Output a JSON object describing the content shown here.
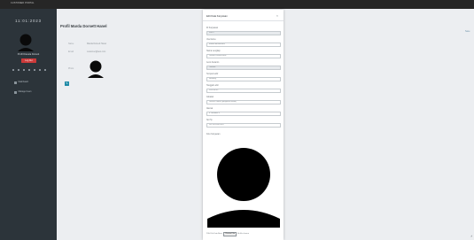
{
  "navbar": {
    "brand": "CUSTOMER PORTAL"
  },
  "sidebar": {
    "clock": "11:01:2023",
    "user_name": "Profil Dianela Dorsett",
    "logout_label": "Log Out",
    "items": [
      {
        "label": "Dashboard",
        "icon": "home-icon"
      },
      {
        "label": "Manage Users",
        "icon": "users-icon"
      }
    ]
  },
  "main": {
    "title": "Profil Marda Dorsett Hanel",
    "fields": [
      {
        "label": "Name",
        "value": "Marda Dorsett Hanel"
      },
      {
        "label": "Email",
        "value": "customer@test.com"
      },
      {
        "label": "Photo",
        "value": ""
      }
    ],
    "edit_icon": "pencil-icon",
    "save_label": "Save"
  },
  "modal": {
    "title": "Edit Data Karyawan",
    "close_icon": "close-icon",
    "fields": [
      {
        "label": "ID Karyawan",
        "value": "00013",
        "readonly": true
      },
      {
        "label": "Username",
        "value": "dianela.dorsetthane",
        "readonly": false
      },
      {
        "label": "Nama Lengkap",
        "value": "Dianela Dorsett Hane",
        "readonly": false
      },
      {
        "label": "Jenis Kelamin",
        "value": "Laki-laki",
        "readonly": true
      },
      {
        "label": "Tempat Lahir",
        "value": "Bandung",
        "readonly": false
      },
      {
        "label": "Tanggal Lahir",
        "value": "2023-04-05",
        "readonly": false
      },
      {
        "label": "Jabatan",
        "value": "Directur Utama (pengelola utama)",
        "readonly": false
      },
      {
        "label": "Alamat",
        "value": "Jl. Merdeka 5",
        "readonly": false
      },
      {
        "label": "No Hp",
        "value": "+62 81234567890",
        "readonly": false
      }
    ],
    "photo_label": "Foto Karyawan",
    "file_prefix": "Pilih File Foto Baru:",
    "file_button": "Choose File",
    "file_status": "No file chosen"
  }
}
